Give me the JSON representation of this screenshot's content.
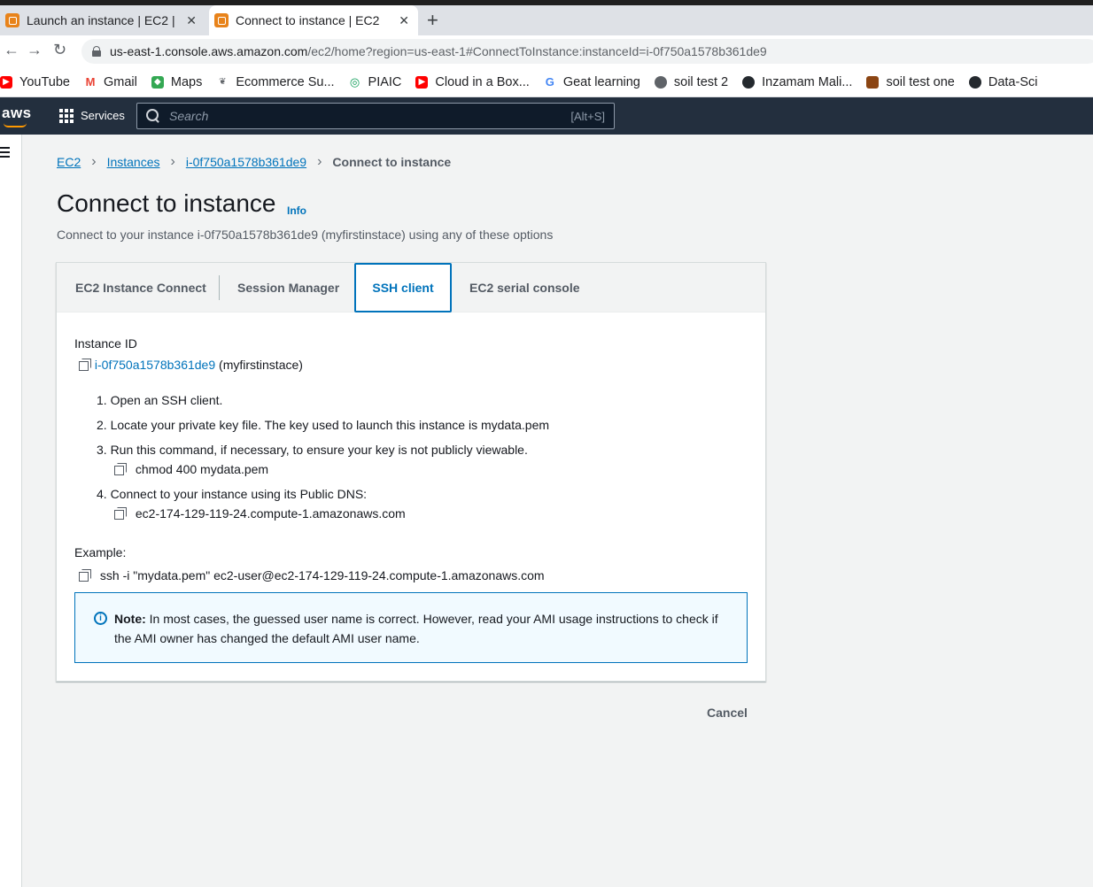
{
  "browser": {
    "tabs": [
      {
        "title": "Launch an instance | EC2 |",
        "active": false
      },
      {
        "title": "Connect to instance | EC2",
        "active": true
      }
    ],
    "new_tab": "+",
    "close_glyph": "✕",
    "url_host": "us-east-1.console.aws.amazon.com",
    "url_path": "/ec2/home?region=us-east-1#ConnectToInstance:instanceId=i-0f750a1578b361de9",
    "bookmarks": [
      {
        "label": "YouTube",
        "icon": "youtube-icon",
        "color": "#ff0000"
      },
      {
        "label": "Gmail",
        "icon": "gmail-icon",
        "color": "#ea4335"
      },
      {
        "label": "Maps",
        "icon": "maps-icon",
        "color": "#34a853"
      },
      {
        "label": "Ecommerce Su...",
        "icon": "leaf-icon",
        "color": "#5f6368"
      },
      {
        "label": "PIAIC",
        "icon": "piaic-icon",
        "color": "#0f9d58"
      },
      {
        "label": "Cloud in a Box...",
        "icon": "youtube-icon",
        "color": "#ff0000"
      },
      {
        "label": "Geat learning",
        "icon": "g-icon",
        "color": "#4285f4"
      },
      {
        "label": "soil test 2",
        "icon": "globe-icon",
        "color": "#5f6368"
      },
      {
        "label": "Inzamam Mali...",
        "icon": "github-icon",
        "color": "#24292e"
      },
      {
        "label": "soil test one",
        "icon": "site-icon",
        "color": "#8b4513"
      },
      {
        "label": "Data-Sci",
        "icon": "github-icon",
        "color": "#24292e"
      }
    ]
  },
  "aws": {
    "logo": "aws",
    "services": "Services",
    "search_placeholder": "Search",
    "search_shortcut": "[Alt+S]"
  },
  "breadcrumb": [
    "EC2",
    "Instances",
    "i-0f750a1578b361de9",
    "Connect to instance"
  ],
  "page": {
    "title": "Connect to instance",
    "info": "Info",
    "description": "Connect to your instance i-0f750a1578b361de9 (myfirstinstace) using any of these options"
  },
  "tabs": [
    "EC2 Instance Connect",
    "Session Manager",
    "SSH client",
    "EC2 serial console"
  ],
  "active_tab": "SSH client",
  "ssh": {
    "instance_id_label": "Instance ID",
    "instance_id": "i-0f750a1578b361de9",
    "instance_name": "(myfirstinstace)",
    "steps": [
      "1. Open an SSH client.",
      "2. Locate your private key file. The key used to launch this instance is mydata.pem",
      "3. Run this command, if necessary, to ensure your key is not publicly viewable.",
      "4. Connect to your instance using its Public DNS:"
    ],
    "chmod_cmd": "chmod 400 mydata.pem",
    "public_dns": "ec2-174-129-119-24.compute-1.amazonaws.com",
    "example_label": "Example:",
    "example_cmd": "ssh -i \"mydata.pem\" ec2-user@ec2-174-129-119-24.compute-1.amazonaws.com",
    "note_bold": "Note:",
    "note_text": " In most cases, the guessed user name is correct. However, read your AMI usage instructions to check if the AMI owner has changed the default AMI user name."
  },
  "cancel": "Cancel"
}
